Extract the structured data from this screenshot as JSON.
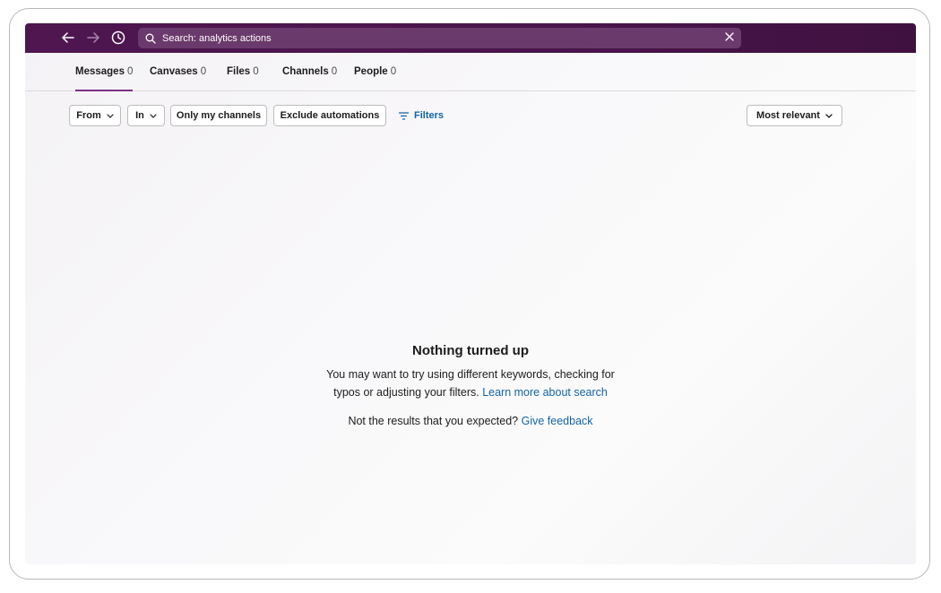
{
  "topbar": {
    "search_text": "Search: analytics actions",
    "icons": [
      "back-arrow-icon",
      "forward-arrow-icon",
      "history-clock-icon",
      "search-icon",
      "close-icon"
    ],
    "colors": {
      "background": "#4a154b",
      "search_background": "#6b3a6c"
    }
  },
  "tabs": [
    {
      "label": "Messages",
      "count": "0",
      "active": true
    },
    {
      "label": "Canvases",
      "count": "0"
    },
    {
      "label": "Files",
      "count": "0"
    },
    {
      "label": "Channels",
      "count": "0"
    },
    {
      "label": "People",
      "count": "0"
    }
  ],
  "filters": {
    "from_label": "From",
    "in_label": "In",
    "only_my_channels_label": "Only my channels",
    "exclude_automations_label": "Exclude automations",
    "filters_link_label": "Filters",
    "sort_label": "Most relevant"
  },
  "empty_state": {
    "title": "Nothing turned up",
    "message_line1": "You may want to try using different keywords, checking for",
    "message_line2": "typos or adjusting your filters.",
    "learn_more_link": "Learn more about search",
    "feedback_prompt": "Not the results that you expected?",
    "feedback_link": "Give feedback"
  },
  "colors": {
    "accent": "#7c3085",
    "link": "#1264a3"
  }
}
